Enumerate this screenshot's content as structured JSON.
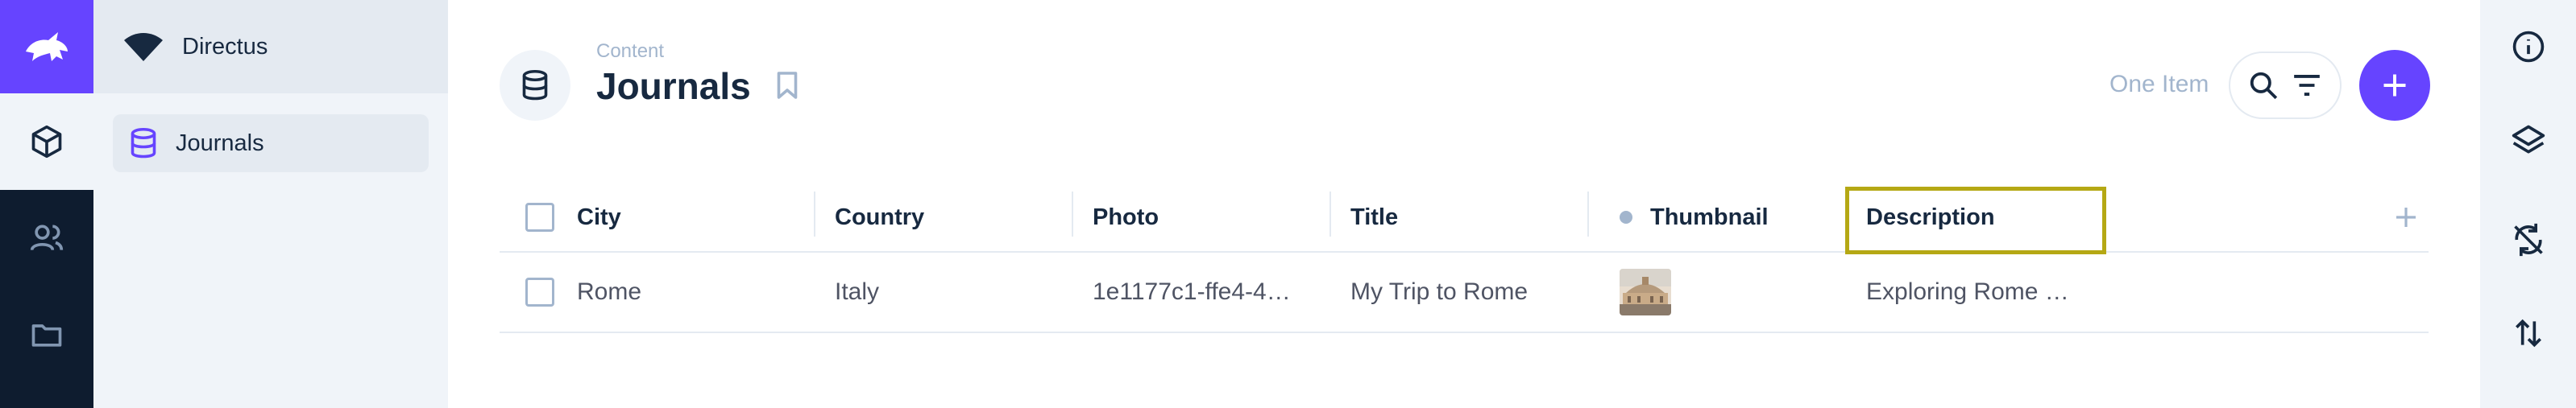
{
  "rail": {
    "logo_icon": "directus-rabbit-icon",
    "items": [
      {
        "icon": "box-icon",
        "active": true
      },
      {
        "icon": "users-icon",
        "active": false
      },
      {
        "icon": "folder-icon",
        "active": false
      }
    ]
  },
  "nav": {
    "project_icon": "wifi-icon",
    "project_name": "Directus",
    "items": [
      {
        "icon": "database-icon",
        "label": "Journals"
      }
    ]
  },
  "header": {
    "breadcrumb": "Content",
    "title": "Journals",
    "item_count": "One Item"
  },
  "table": {
    "columns": [
      "City",
      "Country",
      "Photo",
      "Title",
      "Thumbnail",
      "Description"
    ],
    "rows": [
      {
        "city": "Rome",
        "country": "Italy",
        "photo": "1e1177c1-ffe4-4…",
        "title": "My Trip to Rome",
        "thumbnail": "thumbnail-image",
        "description": "Exploring Rome …"
      }
    ]
  },
  "right_sidebar": {
    "items": [
      "info-icon",
      "layers-icon",
      "sync-off-icon",
      "sort-icon"
    ]
  },
  "colors": {
    "accent": "#6644ff",
    "rail_bg": "#0e1c2f",
    "nav_bg": "#f0f4f9",
    "highlight": "#b5a814"
  }
}
